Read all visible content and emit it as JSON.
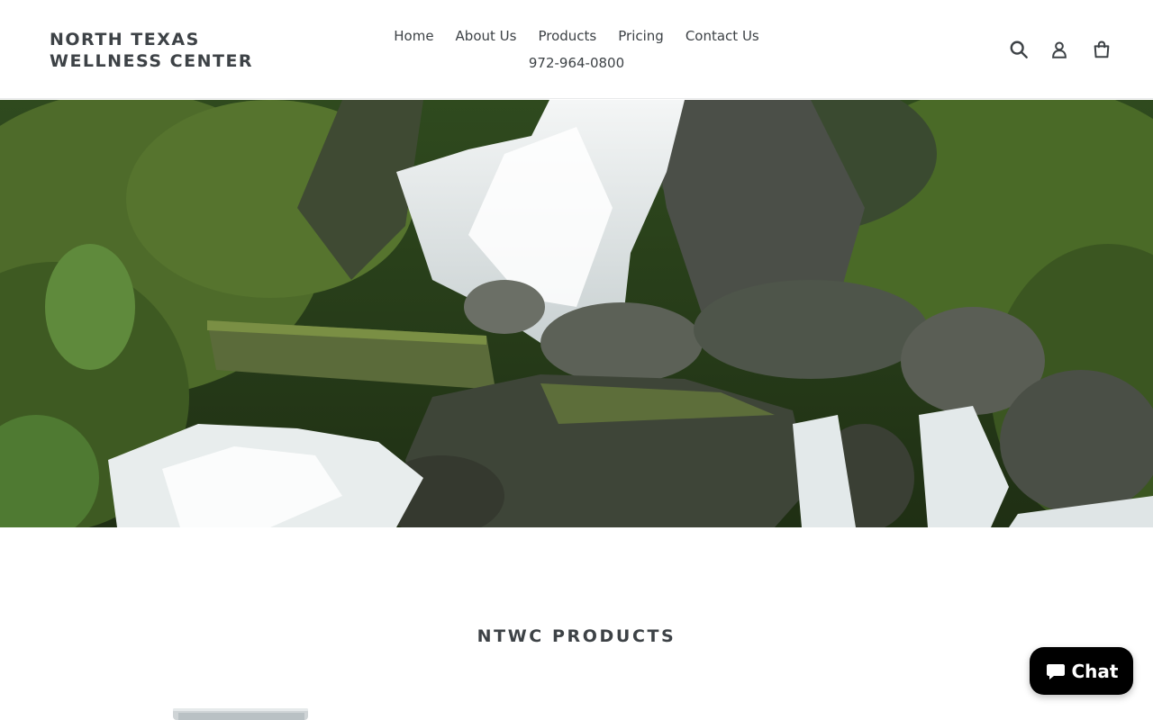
{
  "header": {
    "logo_line1": "NORTH TEXAS",
    "logo_line2": "WELLNESS CENTER",
    "nav": [
      "Home",
      "About Us",
      "Products",
      "Pricing",
      "Contact Us"
    ],
    "phone": "972-964-0800",
    "icons": {
      "search": "search-icon",
      "account": "account-icon",
      "cart": "cart-icon"
    }
  },
  "hero": {
    "alt": "waterfall-image"
  },
  "products": {
    "title": "NTWC PRODUCTS"
  },
  "chat": {
    "label": "Chat",
    "icon": "chat-bubble-icon"
  },
  "colors": {
    "text": "#3d4246",
    "header_border": "#e8e9eb",
    "chat_bg": "#000000",
    "chat_text": "#ffffff"
  }
}
